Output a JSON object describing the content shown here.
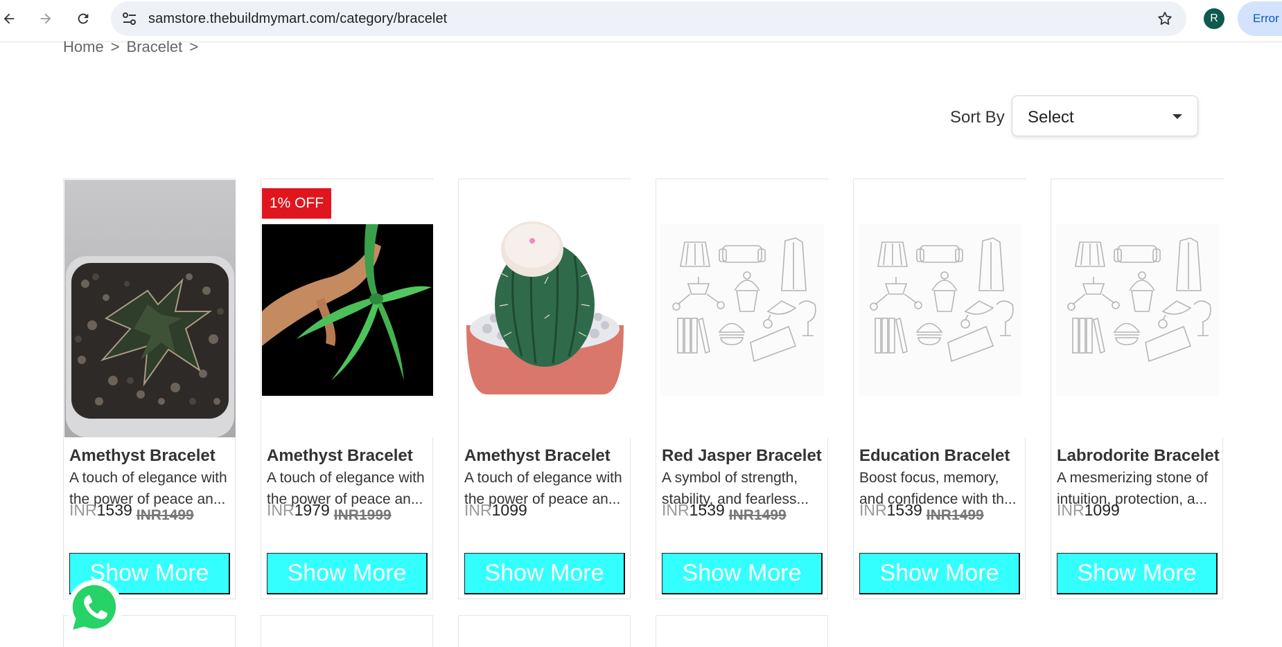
{
  "browser": {
    "url": "samstore.thebuildmymart.com/category/bracelet",
    "profile_initial": "R",
    "error_label": "Error"
  },
  "breadcrumb": {
    "items": [
      "Home",
      ">",
      "Bracelet",
      ">"
    ]
  },
  "sort": {
    "label": "Sort By",
    "selected": "Select"
  },
  "products": [
    {
      "name": "Amethyst Bracelet",
      "desc_line1": "A touch of elegance with",
      "desc_line2": "the power of peace an...",
      "currency": "INR",
      "price": "1539",
      "old_price": "INR1499",
      "badge": "",
      "button": "Show More",
      "image": "succulent-plant"
    },
    {
      "name": "Amethyst Bracelet",
      "desc_line1": "A touch of elegance with",
      "desc_line2": "the power of peace an...",
      "currency": "INR",
      "price": "1979",
      "old_price": "INR1999",
      "badge": "1% OFF",
      "button": "Show More",
      "image": "hand-with-plant"
    },
    {
      "name": "Amethyst Bracelet",
      "desc_line1": "A touch of elegance with",
      "desc_line2": "the power of peace an...",
      "currency": "INR",
      "price": "1099",
      "old_price": "",
      "badge": "",
      "button": "Show More",
      "image": "cactus"
    },
    {
      "name": "Red Jasper Bracelet",
      "desc_line1": "A symbol of strength,",
      "desc_line2": "stability, and fearless...",
      "currency": "INR",
      "price": "1539",
      "old_price": "INR1499",
      "badge": "",
      "button": "Show More",
      "image": "placeholder-doodle"
    },
    {
      "name": "Education Bracelet",
      "desc_line1": "Boost focus, memory,",
      "desc_line2": "and confidence with th...",
      "currency": "INR",
      "price": "1539",
      "old_price": "INR1499",
      "badge": "",
      "button": "Show More",
      "image": "placeholder-doodle"
    },
    {
      "name": "Labrodorite Bracelet",
      "desc_line1": "A mesmerizing stone of",
      "desc_line2": "intuition, protection, a...",
      "currency": "INR",
      "price": "1099",
      "old_price": "",
      "badge": "",
      "button": "Show More",
      "image": "placeholder-doodle"
    }
  ],
  "colors": {
    "button_bg": "#33ffff",
    "badge_bg": "#e0161f",
    "whatsapp_green": "#25d366"
  }
}
